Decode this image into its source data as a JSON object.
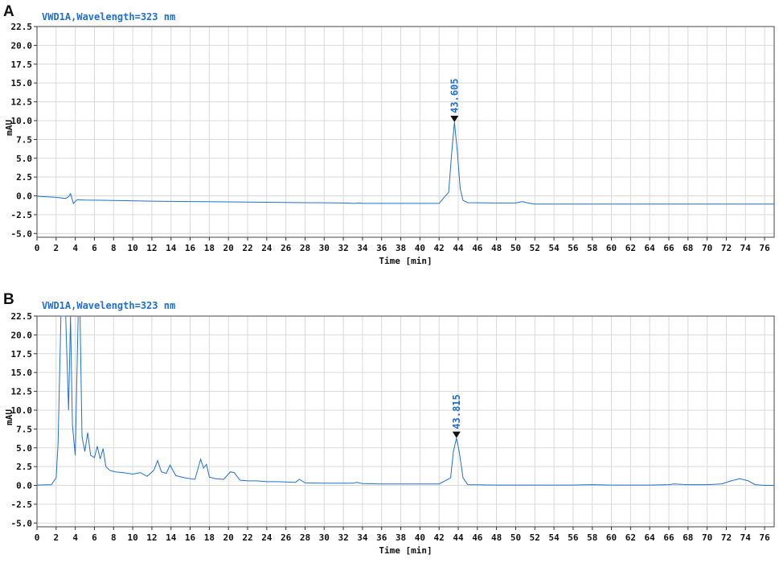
{
  "chart_data": [
    {
      "panel": "A",
      "type": "line",
      "title": "VWD1A,Wavelength=323 nm",
      "xlabel": "Time [min]",
      "ylabel": "mAU",
      "xlim": [
        0,
        77
      ],
      "ylim": [
        -5.5,
        22.5
      ],
      "xticks": [
        0,
        2,
        4,
        6,
        8,
        10,
        12,
        14,
        16,
        18,
        20,
        22,
        24,
        26,
        28,
        30,
        32,
        34,
        36,
        38,
        40,
        42,
        44,
        46,
        48,
        50,
        52,
        54,
        56,
        58,
        60,
        62,
        64,
        66,
        68,
        70,
        72,
        74,
        76
      ],
      "yticks": [
        "22.5",
        "20.0",
        "17.5",
        "15.0",
        "12.5",
        "10.0",
        "7.5",
        "5.0",
        "2.5",
        "0.0",
        "-2.5",
        "-5.0"
      ],
      "grid": true,
      "series": [
        {
          "color": "#1f6fd6",
          "x": [
            0,
            2,
            3.0,
            3.3,
            3.5,
            3.8,
            4.2,
            5,
            8,
            12,
            16,
            20,
            24,
            28,
            30,
            32,
            33.2,
            33.6,
            34,
            38,
            42,
            43.0,
            43.3,
            43.605,
            43.9,
            44.2,
            44.5,
            45,
            48,
            50,
            50.7,
            51.3,
            52,
            56,
            60,
            64,
            68,
            72,
            76,
            77
          ],
          "y": [
            -0.05,
            -0.2,
            -0.35,
            -0.1,
            0.3,
            -1.0,
            -0.5,
            -0.55,
            -0.6,
            -0.7,
            -0.75,
            -0.8,
            -0.85,
            -0.9,
            -0.92,
            -0.95,
            -1.0,
            -0.95,
            -1.0,
            -1.0,
            -1.0,
            0.5,
            5.5,
            9.8,
            6.0,
            1.0,
            -0.6,
            -0.9,
            -0.95,
            -0.95,
            -0.75,
            -0.95,
            -1.1,
            -1.1,
            -1.1,
            -1.1,
            -1.1,
            -1.1,
            -1.1,
            -1.1
          ]
        }
      ],
      "annotations": [
        {
          "label": "43.605",
          "x": 43.605,
          "y": 9.8
        }
      ]
    },
    {
      "panel": "B",
      "type": "line",
      "title": "VWD1A,Wavelength=323 nm",
      "xlabel": "Time [min]",
      "ylabel": "mAU",
      "xlim": [
        0,
        77
      ],
      "ylim": [
        -5.5,
        22.5
      ],
      "xticks": [
        0,
        2,
        4,
        6,
        8,
        10,
        12,
        14,
        16,
        18,
        20,
        22,
        24,
        26,
        28,
        30,
        32,
        34,
        36,
        38,
        40,
        42,
        44,
        46,
        48,
        50,
        52,
        54,
        56,
        58,
        60,
        62,
        64,
        66,
        68,
        70,
        72,
        74,
        76
      ],
      "yticks": [
        "22.5",
        "20.0",
        "17.5",
        "15.0",
        "12.5",
        "10.0",
        "7.5",
        "5.0",
        "2.5",
        "0.0",
        "-2.5",
        "-5.0"
      ],
      "grid": true,
      "series": [
        {
          "color": "#1f6fd6",
          "x": [
            0,
            1.5,
            2.0,
            2.2,
            2.5,
            2.8,
            3.0,
            3.3,
            3.5,
            3.7,
            4.0,
            4.3,
            4.5,
            4.7,
            5.0,
            5.3,
            5.6,
            6.0,
            6.3,
            6.6,
            6.9,
            7.2,
            7.6,
            8.2,
            9,
            10,
            10.8,
            11.5,
            12.2,
            12.6,
            13.0,
            13.5,
            13.9,
            14.5,
            15.5,
            16.5,
            17.1,
            17.4,
            17.7,
            18.0,
            18.6,
            19.5,
            20.2,
            20.6,
            21.2,
            22,
            23,
            24,
            25,
            26,
            27,
            27.4,
            28,
            30,
            32,
            33,
            33.4,
            34,
            36,
            40,
            42,
            43.2,
            43.5,
            43.815,
            44.1,
            44.5,
            45,
            48,
            52,
            56,
            58,
            60,
            64,
            66,
            66.5,
            68,
            70,
            71.5,
            72.5,
            73.4,
            74.3,
            75,
            76,
            77
          ],
          "y": [
            0.05,
            0.1,
            1.0,
            5.5,
            22.5,
            22.5,
            22.5,
            10.0,
            22.5,
            8.0,
            4.0,
            22.5,
            22.5,
            6.5,
            4.5,
            7.0,
            4.0,
            3.7,
            5.2,
            3.5,
            4.9,
            2.5,
            2.0,
            1.8,
            1.7,
            1.5,
            1.7,
            1.2,
            2.0,
            3.3,
            1.8,
            1.6,
            2.7,
            1.3,
            1.0,
            0.8,
            3.5,
            2.3,
            2.8,
            1.1,
            0.9,
            0.8,
            1.8,
            1.7,
            0.7,
            0.6,
            0.6,
            0.5,
            0.5,
            0.45,
            0.4,
            0.8,
            0.35,
            0.3,
            0.3,
            0.3,
            0.4,
            0.25,
            0.2,
            0.2,
            0.2,
            1.0,
            4.5,
            6.3,
            4.5,
            1.0,
            0.1,
            0.05,
            0.05,
            0.05,
            0.1,
            0.05,
            0.05,
            0.1,
            0.2,
            0.1,
            0.1,
            0.2,
            0.6,
            0.9,
            0.6,
            0.1,
            0.0,
            0.0
          ]
        }
      ],
      "annotations": [
        {
          "label": "43.815",
          "x": 43.815,
          "y": 6.3
        }
      ]
    }
  ]
}
